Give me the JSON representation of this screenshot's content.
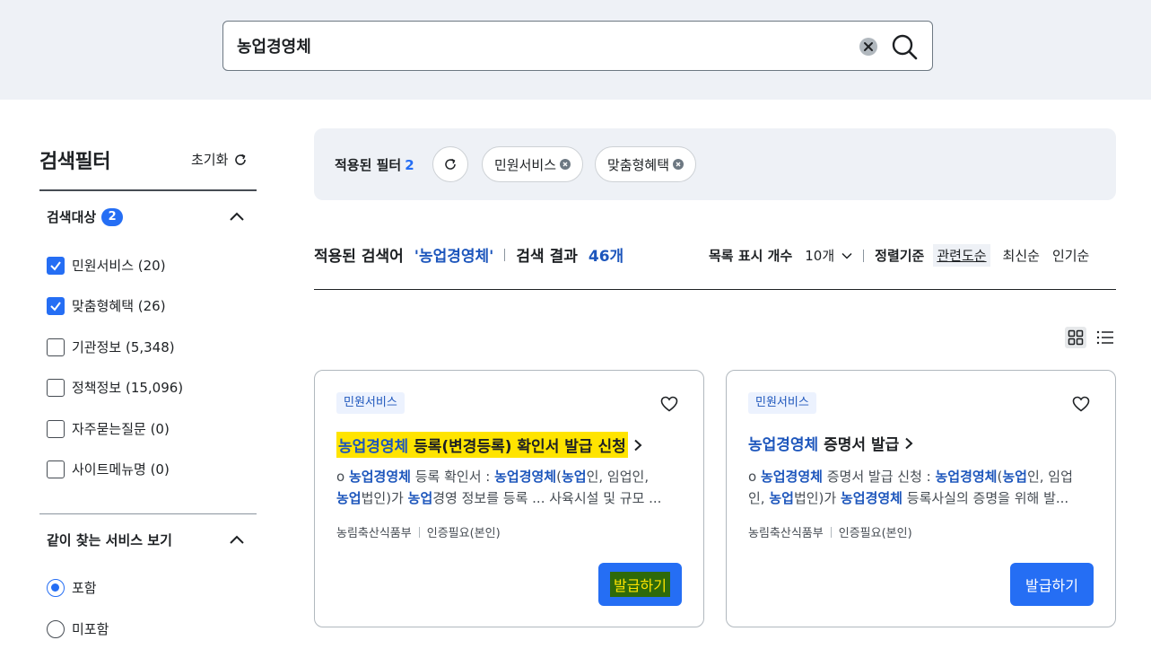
{
  "search": {
    "value": "농업경영체"
  },
  "sidebar": {
    "title": "검색필터",
    "reset_label": "초기화",
    "target_section": {
      "label": "검색대상",
      "count": "2",
      "items": [
        {
          "label": "민원서비스 (20)",
          "checked": true
        },
        {
          "label": "맞춤형혜택 (26)",
          "checked": true
        },
        {
          "label": "기관정보 (5,348)",
          "checked": false
        },
        {
          "label": "정책정보 (15,096)",
          "checked": false
        },
        {
          "label": "자주묻는질문 (0)",
          "checked": false
        },
        {
          "label": "사이트메뉴명 (0)",
          "checked": false
        }
      ]
    },
    "related_section": {
      "label": "같이 찾는 서비스 보기",
      "options": [
        {
          "label": "포함",
          "selected": true
        },
        {
          "label": "미포함",
          "selected": false
        }
      ]
    }
  },
  "applied": {
    "label": "적용된 필터",
    "count": "2",
    "chips": [
      "민원서비스",
      "맞춤형혜택"
    ]
  },
  "summary": {
    "label": "적용된 검색어",
    "keyword": "'농업경영체'",
    "result_label": "검색 결과",
    "result_count": "46개"
  },
  "list_controls": {
    "per_page_label": "목록 표시 개수",
    "per_page_value": "10개",
    "sort_label": "정렬기준",
    "sort_options": [
      "관련도순",
      "최신순",
      "인기순"
    ]
  },
  "cards": [
    {
      "tag": "민원서비스",
      "title_kw": "농업경영체",
      "title_rest": " 등록(변경등록) 확인서 발급 신청",
      "desc_line1": [
        "o ",
        "농업경영체",
        " 등록 확인서 : ",
        "농업경영체",
        "(",
        "농업",
        "인, 임업인,"
      ],
      "desc_line2": [
        "농업",
        "법인)가 ",
        "농업",
        "경영 정보를 등록 ... 사육시설 및 규모 ..."
      ],
      "agency": "농림축산식품부",
      "auth": "인증필요(본인)",
      "button": "발급하기"
    },
    {
      "tag": "민원서비스",
      "title_kw": "농업경영체",
      "title_rest": " 증명서 발급",
      "desc_line1": [
        "o ",
        "농업경영체",
        " 증명서 발급 신청 : ",
        "농업경영체",
        "(",
        "농업",
        "인, 임업"
      ],
      "desc_line2": [
        "인, ",
        "농업",
        "법인)가 ",
        "농업경영체",
        " 등록사실의 증명을 위해 발..."
      ],
      "agency": "농림축산식품부",
      "auth": "인증필요(본인)",
      "button": "발급하기"
    }
  ]
}
